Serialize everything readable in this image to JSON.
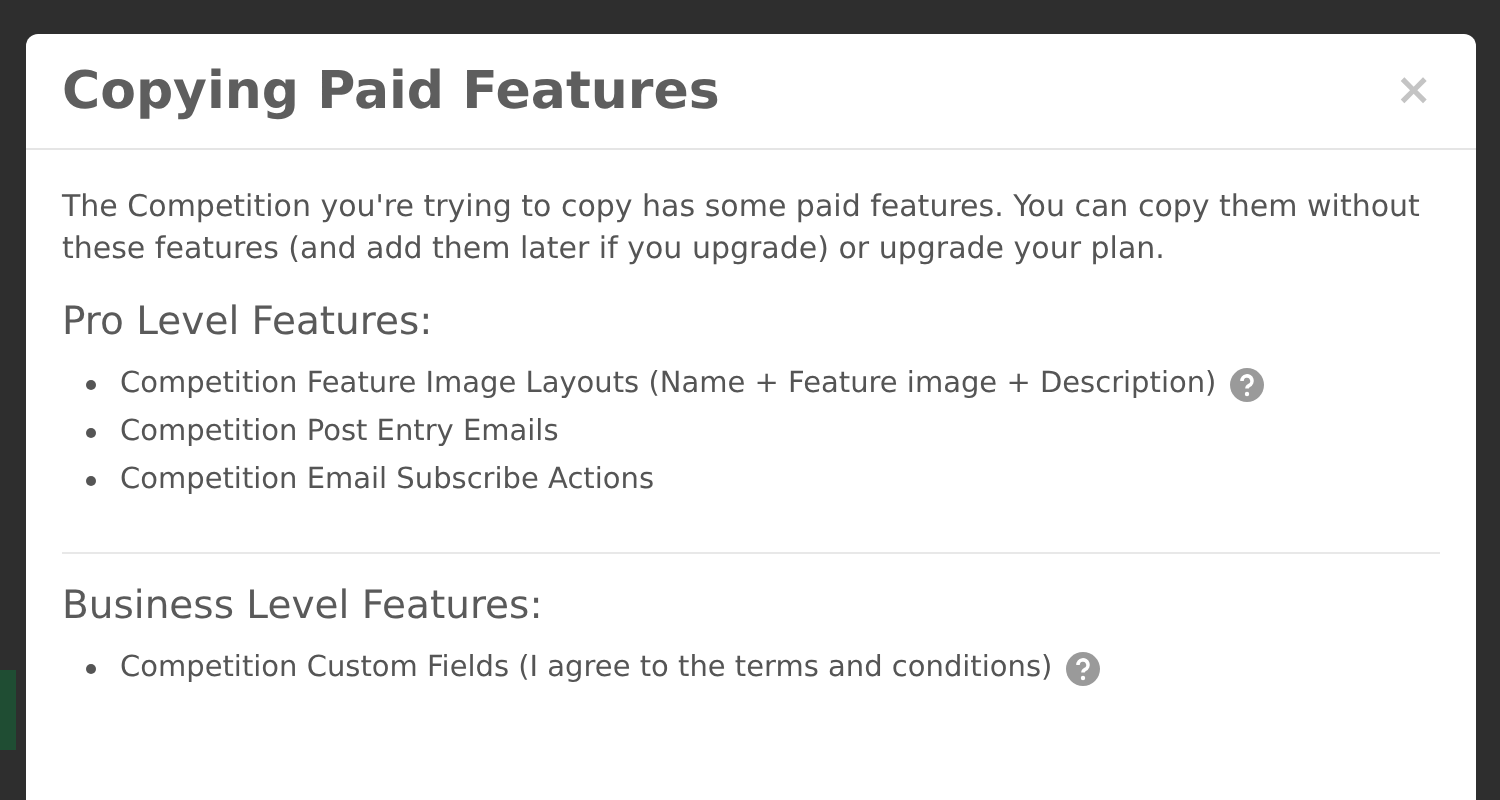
{
  "modal": {
    "title": "Copying Paid Features",
    "close": "×",
    "intro": "The Competition you're trying to copy has some paid features. You can copy them without these features (and add them later if you upgrade) or upgrade your plan.",
    "sections": [
      {
        "heading": "Pro Level Features:",
        "items": [
          {
            "text": "Competition Feature Image Layouts (Name + Feature image + Description)",
            "help": true
          },
          {
            "text": "Competition Post Entry Emails",
            "help": false
          },
          {
            "text": "Competition Email Subscribe Actions",
            "help": false
          }
        ]
      },
      {
        "heading": "Business Level Features:",
        "items": [
          {
            "text": "Competition Custom Fields (I agree to the terms and conditions)",
            "help": true
          }
        ]
      }
    ]
  }
}
